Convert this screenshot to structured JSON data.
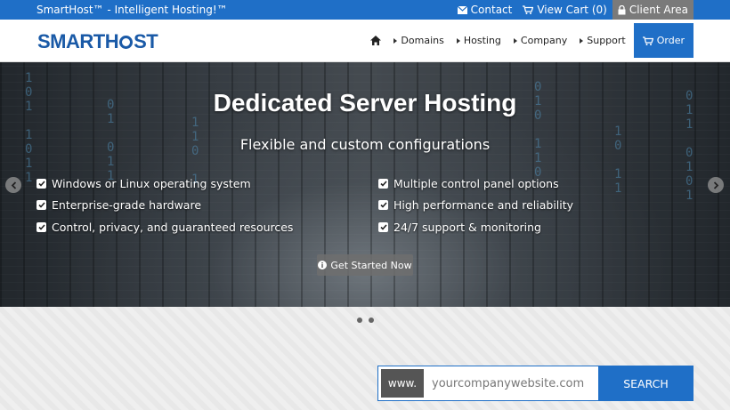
{
  "topbar": {
    "tagline": "SmartHost™ - Intelligent Hosting!™",
    "contact": "Contact",
    "cart": "View Cart (0)",
    "client_area": "Client Area"
  },
  "header": {
    "logo_left": "SMARTH",
    "logo_right": "ST",
    "nav": {
      "domains": "Domains",
      "hosting": "Hosting",
      "company": "Company",
      "support": "Support",
      "order": "Order"
    }
  },
  "hero": {
    "title": "Dedicated Server Hosting",
    "subtitle": "Flexible and custom configurations",
    "features_left": [
      "Windows or Linux operating system",
      "Enterprise-grade hardware",
      "Control, privacy, and guaranteed resources"
    ],
    "features_right": [
      "Multiple control panel options",
      "High performance and reliability",
      "24/7 support & monitoring"
    ],
    "cta": "Get Started Now"
  },
  "domain_search": {
    "prefix": "www.",
    "placeholder": "yourcompanywebsite.com",
    "button": "SEARCH"
  },
  "colors": {
    "brand_blue": "#1f6fc7",
    "client_gray": "#7a7a7a"
  }
}
